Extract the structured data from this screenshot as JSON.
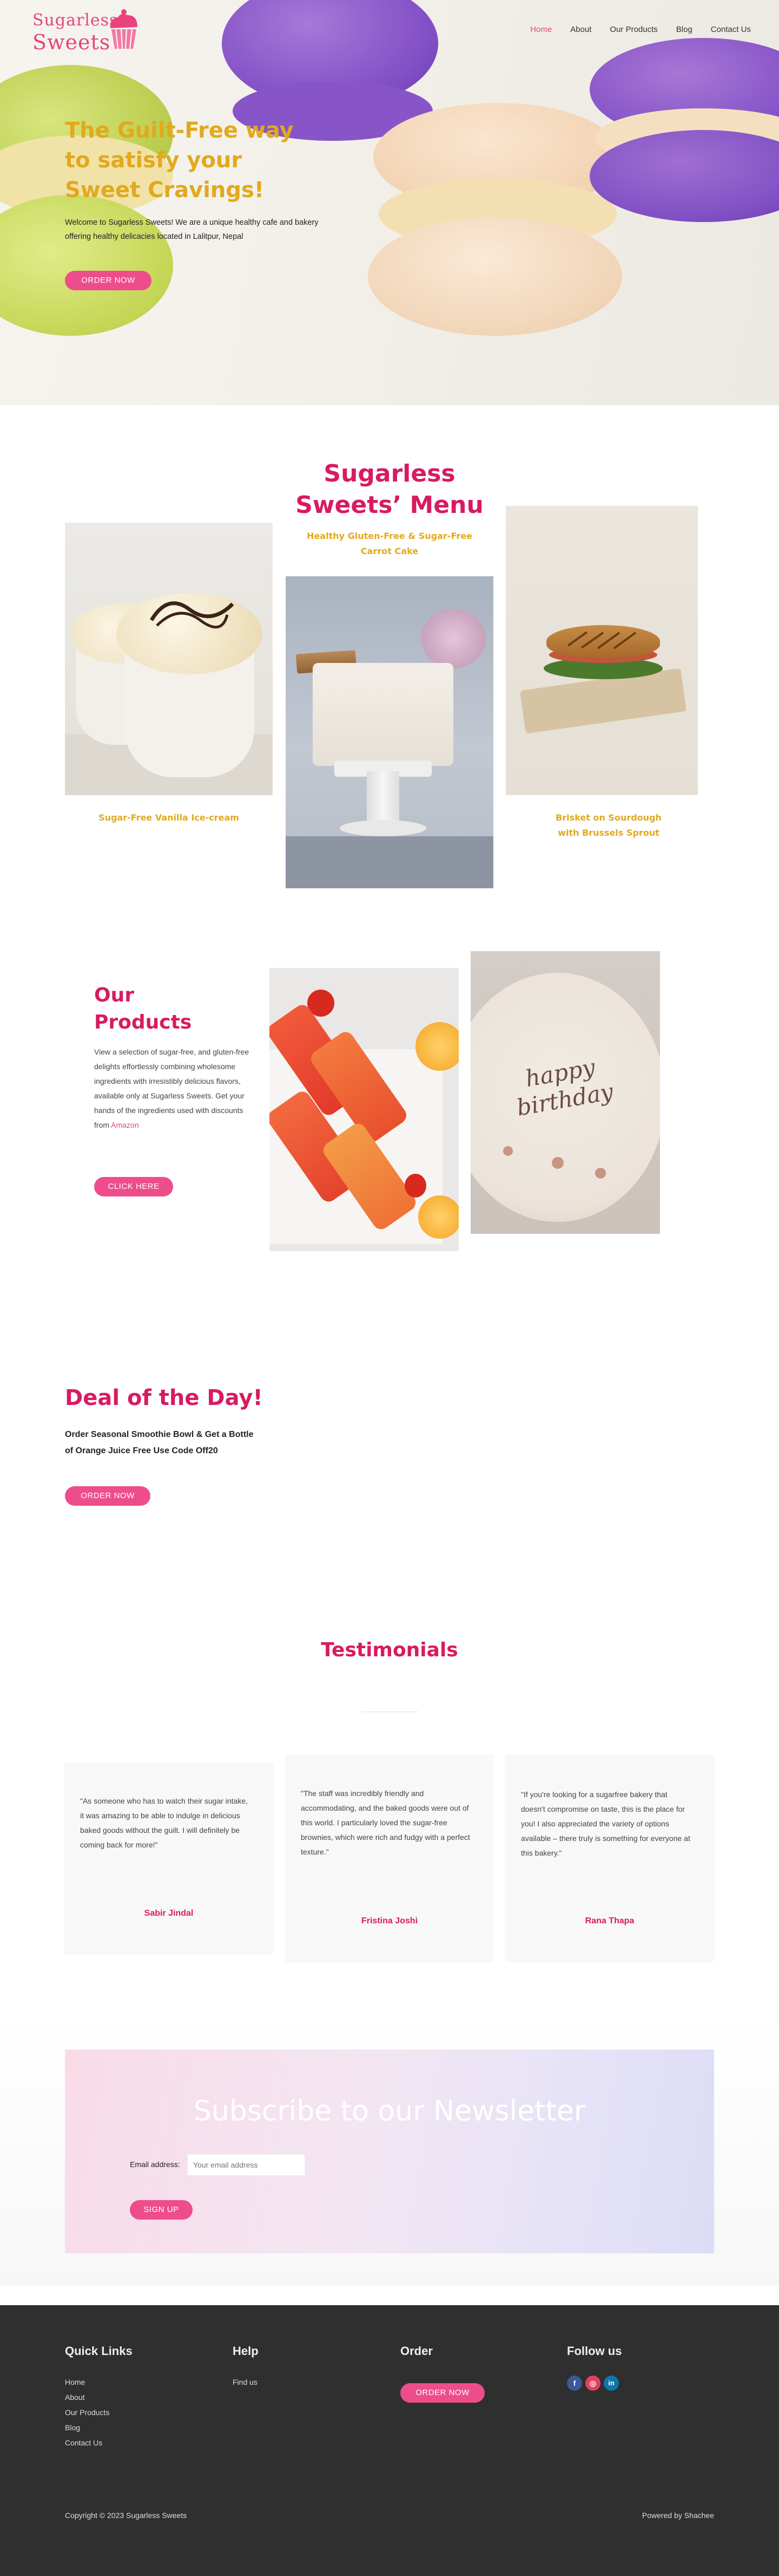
{
  "brand": {
    "line1": "Sugarless",
    "line2": "Sweets",
    "accent": "#e8437f",
    "gold": "#e2a91c"
  },
  "nav": {
    "items": [
      {
        "label": "Home",
        "active": true
      },
      {
        "label": "About"
      },
      {
        "label": "Our Products"
      },
      {
        "label": "Blog"
      },
      {
        "label": "Contact Us"
      }
    ]
  },
  "hero": {
    "title": "The Guilt-Free way to satisfy your Sweet Cravings!",
    "text": "Welcome to Sugarless Sweets! We are a unique healthy cafe and bakery offering healthy delicacies located in Lalitpur, Nepal",
    "button": "ORDER NOW"
  },
  "menu": {
    "title": "Sugarless Sweets’ Menu",
    "items": [
      {
        "caption": "Sugar-Free Vanilla Ice-cream",
        "image": "ice-cream-cups"
      },
      {
        "caption": "Healthy Gluten-Free & Sugar-Free Carrot Cake",
        "image": "carrot-cake"
      },
      {
        "caption": "Brisket on Sourdough with Brussels Sprout",
        "image": "sandwich"
      }
    ]
  },
  "products": {
    "title": "Our Products",
    "text": "View a selection of sugar-free, and gluten-free delights effortlessly combining wholesome ingredients with irresistibly delicious flavors, available only at Sugarless Sweets. Get your hands of the ingredients used with discounts from",
    "link": "Amazon",
    "button": "CLICK HERE",
    "cake_text": "happy birthday"
  },
  "deal": {
    "title": "Deal of the Day!",
    "text": "Order Seasonal Smoothie Bowl & Get a Bottle of Orange Juice Free Use Code Off20",
    "button": "ORDER NOW"
  },
  "testimonials": {
    "title": "Testimonials",
    "items": [
      {
        "quote": "\"As someone who has to watch their sugar intake, it was amazing to be able to indulge in delicious baked goods without the guilt. I will definitely be coming back for more!\"",
        "name": "Sabir Jindal"
      },
      {
        "quote": "\"The staff was incredibly friendly and accommodating, and the baked goods were out of this world. I particularly loved the sugar-free brownies, which were rich and fudgy with a perfect texture.\"",
        "name": "Fristina Joshi"
      },
      {
        "quote": "\"If you're looking for a sugarfree bakery that doesn't compromise on taste, this is the place for you! I also appreciated the variety of options available – there truly is something for everyone at this bakery.\"",
        "name": "Rana Thapa"
      }
    ]
  },
  "newsletter": {
    "title": "Subscribe to our Newsletter",
    "email_label": "Email address:",
    "email_placeholder": "Your email address",
    "button": "SIGN UP"
  },
  "footer": {
    "quick_links": {
      "title": "Quick Links",
      "items": [
        "Home",
        "About",
        "Our Products",
        "Blog",
        "Contact Us"
      ]
    },
    "help": {
      "title": "Help",
      "items": [
        "Find us"
      ]
    },
    "order": {
      "title": "Order",
      "button": "ORDER NOW"
    },
    "follow": {
      "title": "Follow us",
      "icons": [
        "facebook-icon",
        "instagram-icon",
        "linkedin-icon"
      ]
    },
    "copyright": "Copyright © 2023 Sugarless Sweets",
    "powered": "Powered by Shachee"
  }
}
